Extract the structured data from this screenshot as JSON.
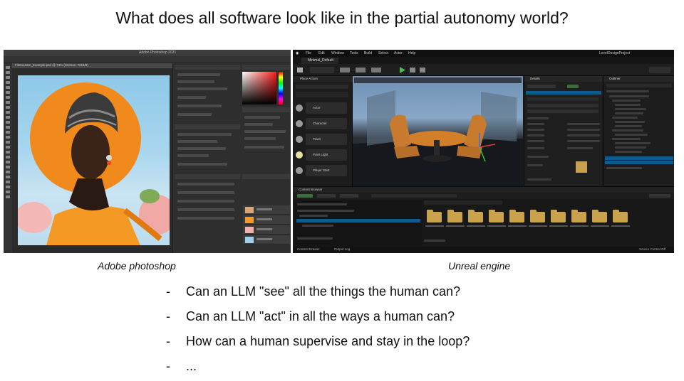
{
  "title": "What does all software look like in the partial autonomy world?",
  "screenshots": {
    "photoshop": {
      "caption": "Adobe photoshop",
      "window_title": "Adobe Photoshop 2021",
      "document_tab": "FiletoLearn_Example.psd @ 74% (Woman, RGB/8)"
    },
    "unreal": {
      "caption": "Unreal engine",
      "menu": [
        "File",
        "Edit",
        "Window",
        "Tools",
        "Build",
        "Select",
        "Actor",
        "Help"
      ],
      "project_name": "LevelDesignProject",
      "level_tab": "Minimal_Default",
      "panels": {
        "place_actors": "Place Actors",
        "details": "Details",
        "outliner": "Outliner",
        "content_browser": "Content Browser"
      },
      "place_items": [
        "Actor",
        "Character",
        "Pawn",
        "Point Light",
        "Player Start"
      ],
      "status_left": "Content Drawer",
      "status_mid": "Output Log",
      "status_right": "Source Control Off"
    }
  },
  "bullets": [
    "Can an LLM \"see\" all the things the human can?",
    "Can an LLM \"act\" in all the ways a human can?",
    "How can a human supervise and stay in the loop?",
    "..."
  ]
}
